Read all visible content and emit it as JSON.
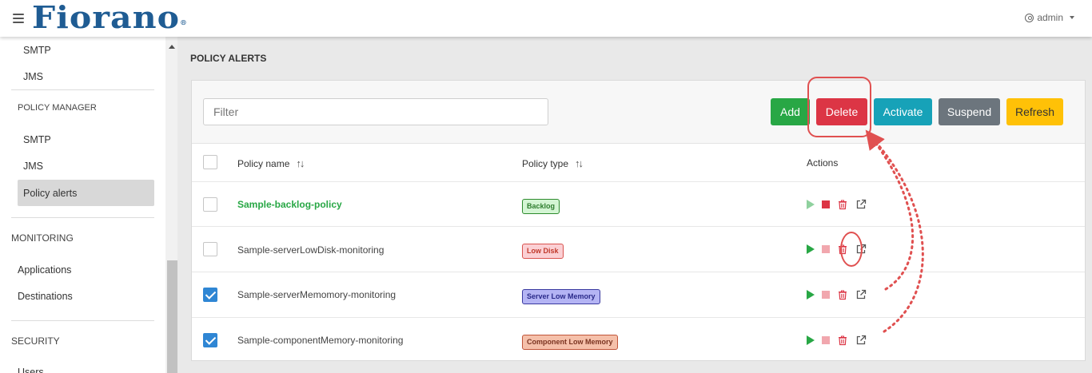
{
  "header": {
    "brand": "Fiorano",
    "trademark": "®",
    "user": "admin"
  },
  "sidebar": {
    "items_top": [
      "SMTP",
      "JMS"
    ],
    "policy_manager": {
      "title": "POLICY MANAGER",
      "items": [
        "SMTP",
        "JMS",
        "Policy alerts"
      ],
      "active": "Policy alerts"
    },
    "monitoring": {
      "title": "MONITORING",
      "items": [
        "Applications",
        "Destinations"
      ]
    },
    "security": {
      "title": "SECURITY",
      "items": [
        "Users"
      ]
    }
  },
  "page": {
    "title": "POLICY ALERTS"
  },
  "toolbar": {
    "filter_placeholder": "Filter",
    "add": "Add",
    "delete": "Delete",
    "activate": "Activate",
    "suspend": "Suspend",
    "refresh": "Refresh"
  },
  "table": {
    "columns": {
      "name": "Policy name",
      "type": "Policy type",
      "actions": "Actions"
    },
    "rows": [
      {
        "name": "Sample-backlog-policy",
        "type": "Backlog",
        "checked": false,
        "highlight": true
      },
      {
        "name": "Sample-serverLowDisk-monitoring",
        "type": "Low Disk",
        "checked": false,
        "highlight": false
      },
      {
        "name": "Sample-serverMemomory-monitoring",
        "type": "Server Low Memory",
        "checked": true,
        "highlight": false
      },
      {
        "name": "Sample-componentMemory-monitoring",
        "type": "Component Low Memory",
        "checked": true,
        "highlight": false
      }
    ]
  },
  "colors": {
    "add": "#28a745",
    "delete": "#dc3545",
    "activate": "#17a2b8",
    "suspend": "#6c757d",
    "refresh": "#ffc107",
    "annotation": "#e05050"
  }
}
